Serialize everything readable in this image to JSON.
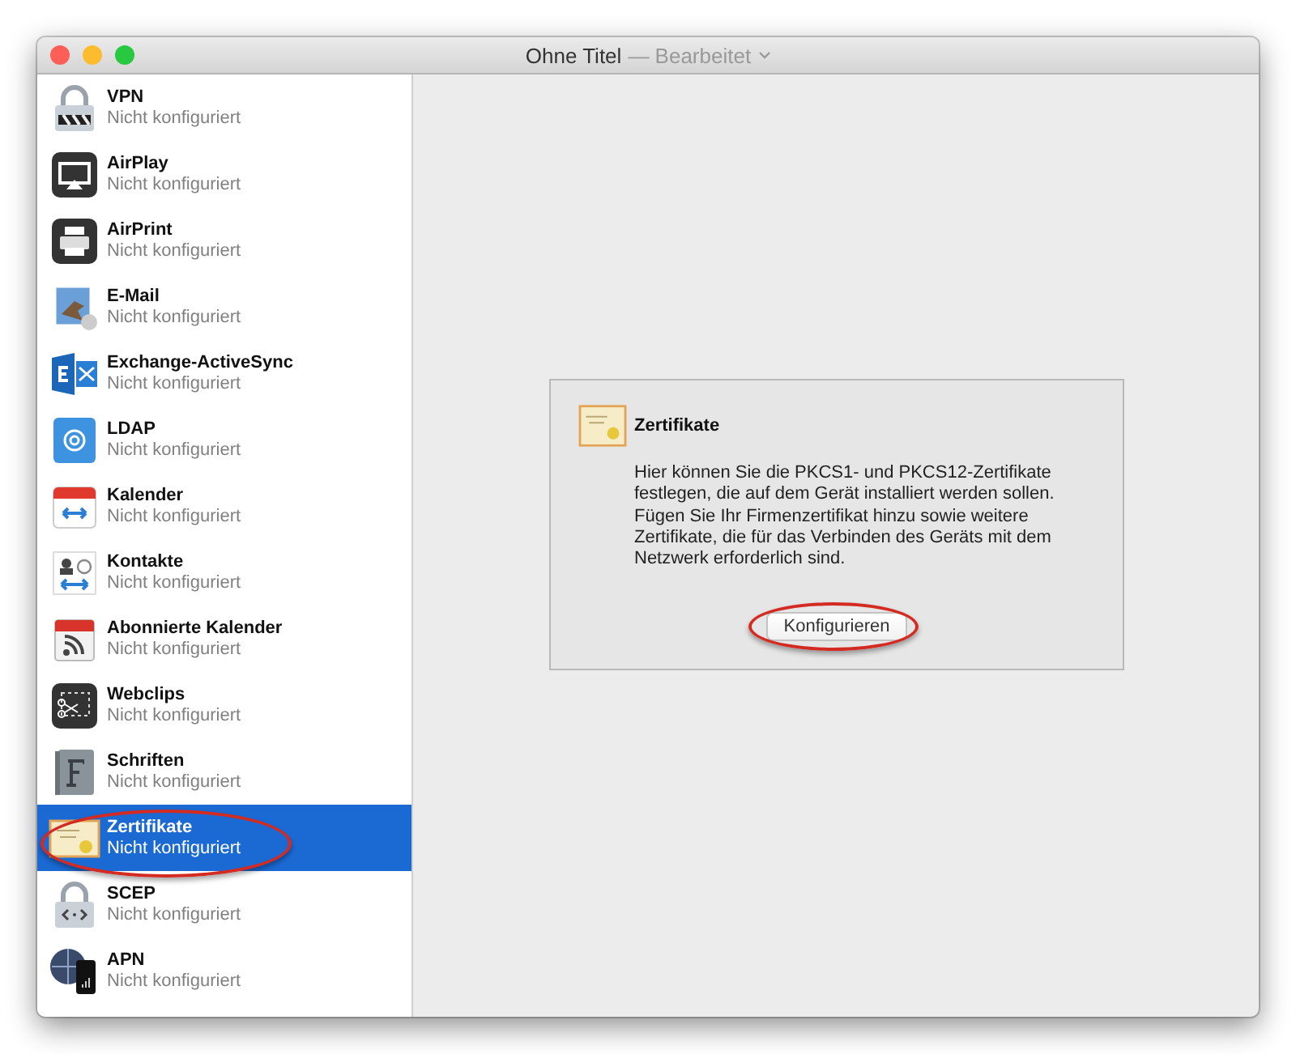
{
  "window": {
    "title": "Ohne Titel",
    "subtitle": "— Bearbeitet"
  },
  "sidebar": {
    "items": [
      {
        "name": "VPN",
        "status": "Nicht konfiguriert",
        "kind": "lock",
        "selected": false,
        "annotated": false
      },
      {
        "name": "AirPlay",
        "status": "Nicht konfiguriert",
        "kind": "airplay",
        "selected": false,
        "annotated": false
      },
      {
        "name": "AirPrint",
        "status": "Nicht konfiguriert",
        "kind": "printer",
        "selected": false,
        "annotated": false
      },
      {
        "name": "E-Mail",
        "status": "Nicht konfiguriert",
        "kind": "mail",
        "selected": false,
        "annotated": false
      },
      {
        "name": "Exchange-ActiveSync",
        "status": "Nicht konfiguriert",
        "kind": "exchange",
        "selected": false,
        "annotated": false
      },
      {
        "name": "LDAP",
        "status": "Nicht konfiguriert",
        "kind": "at",
        "selected": false,
        "annotated": false
      },
      {
        "name": "Kalender",
        "status": "Nicht konfiguriert",
        "kind": "calendar",
        "selected": false,
        "annotated": false
      },
      {
        "name": "Kontakte",
        "status": "Nicht konfiguriert",
        "kind": "contacts",
        "selected": false,
        "annotated": false
      },
      {
        "name": "Abonnierte Kalender",
        "status": "Nicht konfiguriert",
        "kind": "feed",
        "selected": false,
        "annotated": false
      },
      {
        "name": "Webclips",
        "status": "Nicht konfiguriert",
        "kind": "webclip",
        "selected": false,
        "annotated": false
      },
      {
        "name": "Schriften",
        "status": "Nicht konfiguriert",
        "kind": "font",
        "selected": false,
        "annotated": false
      },
      {
        "name": "Zertifikate",
        "status": "Nicht konfiguriert",
        "kind": "certificate",
        "selected": true,
        "annotated": true
      },
      {
        "name": "SCEP",
        "status": "Nicht konfiguriert",
        "kind": "lockcode",
        "selected": false,
        "annotated": false
      },
      {
        "name": "APN",
        "status": "Nicht konfiguriert",
        "kind": "globephone",
        "selected": false,
        "annotated": false
      }
    ]
  },
  "panel": {
    "title": "Zertifikate",
    "text": "Hier können Sie die PKCS1- und PKCS12-Zertifikate festlegen, die auf dem Gerät installiert werden sollen. Fügen Sie Ihr Firmenzertifikat hinzu sowie weitere Zertifikate, die für das Verbinden des Geräts mit dem Netzwerk erforderlich sind.",
    "button": {
      "label": "Konfigurieren",
      "annotated": true
    }
  }
}
